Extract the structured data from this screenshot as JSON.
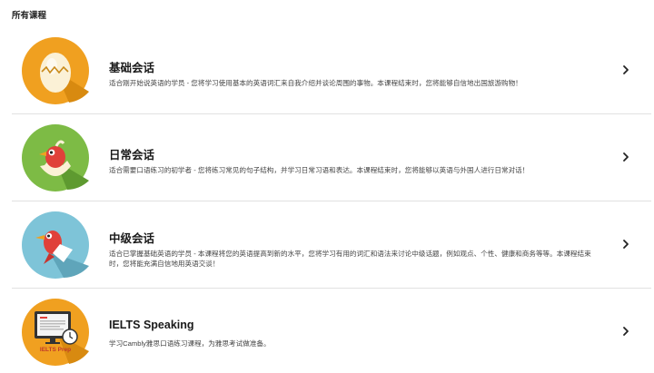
{
  "section_title": "所有课程",
  "courses": [
    {
      "title": "基础会话",
      "description": "适合刚开始说英语的学员 - 您将学习使用基本的英语词汇来自我介绍并谈论周围的事物。本课程结束时，您将能够自信地出国旅游购物！",
      "icon": "cracked-egg-icon",
      "icon_bg": "#F0A020"
    },
    {
      "title": "日常会话",
      "description": "适合需要口语练习的初学者 - 您将练习常见的句子结构，并学习日常习语和表达。本课程结束时，您将能够以英语与外国人进行日常对话！",
      "icon": "hatching-bird-icon",
      "icon_bg": "#7DBB45"
    },
    {
      "title": "中级会话",
      "description": "适合已掌握基础英语的学员 - 本课程将您的英语提高到新的水平，您将学习有用的词汇和语法来讨论中级话题，例如观点、个性、健康和商务等等。本课程结束时，您将能充满自信地用英语交谈！",
      "icon": "flying-bird-icon",
      "icon_bg": "#7EC4D8"
    },
    {
      "title": "IELTS Speaking",
      "description": "学习Cambly雅思口语练习课程，为雅思考试做准备。",
      "icon": "ielts-prep-icon",
      "icon_bg": "#F0A020",
      "icon_caption": "IELTS Prep"
    }
  ]
}
